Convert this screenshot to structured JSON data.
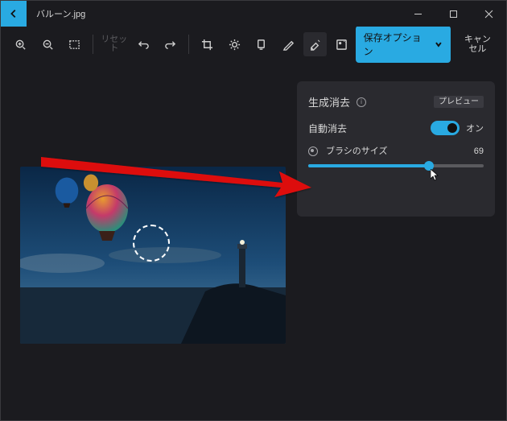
{
  "title": "バルーン.jpg",
  "toolbar": {
    "reset": "リセット",
    "save_options": "保存オプション",
    "cancel": "キャンセル"
  },
  "panel": {
    "title": "生成消去",
    "preview": "プレビュー",
    "auto_erase": "自動消去",
    "on_label": "オン",
    "brush_label": "ブラシのサイズ",
    "brush_value": "69"
  },
  "slider_percent": 69
}
